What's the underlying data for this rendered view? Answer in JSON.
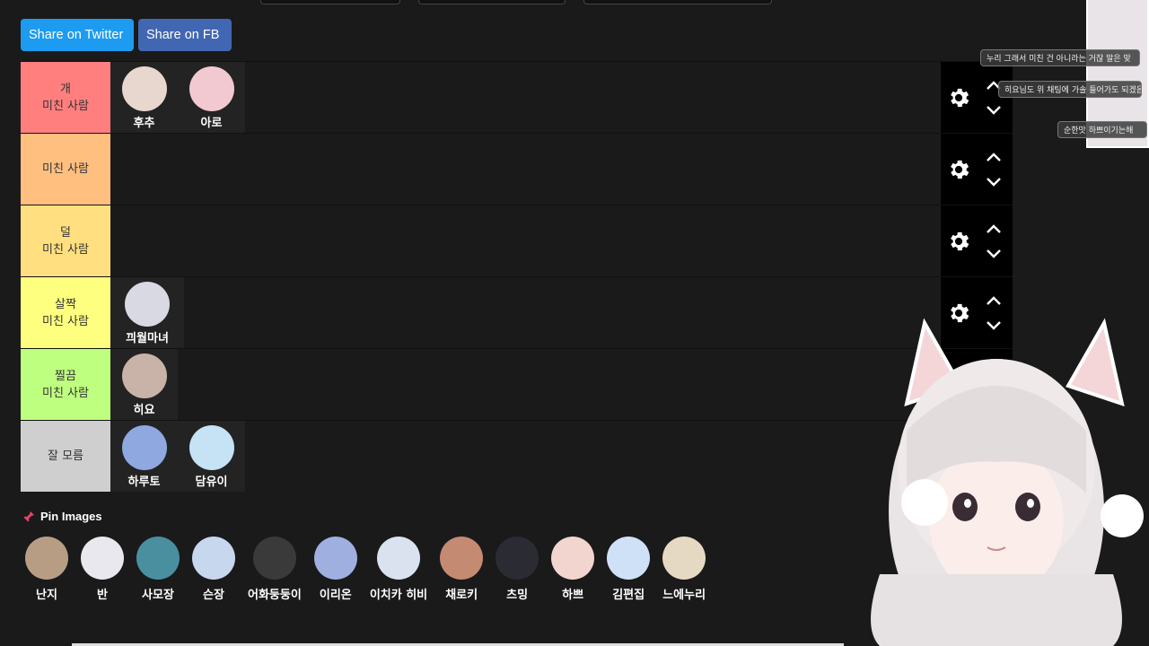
{
  "share": {
    "twitter_label": "Share on Twitter",
    "fb_label": "Share on FB"
  },
  "tiers": [
    {
      "label": "개\n미친 사람",
      "color": "#ff7f7f",
      "items": [
        {
          "name": "후추",
          "color": "#e8d7cf"
        },
        {
          "name": "아로",
          "color": "#f2c9d0"
        }
      ]
    },
    {
      "label": "미친 사람",
      "color": "#ffbf7f",
      "items": []
    },
    {
      "label": "덜\n미친 사람",
      "color": "#ffdf7f",
      "items": []
    },
    {
      "label": "살짝\n미친 사람",
      "color": "#ffff7f",
      "items": [
        {
          "name": "끠월마녀",
          "color": "#d9d9e3"
        }
      ]
    },
    {
      "label": "찔끔\n미친 사람",
      "color": "#bfff7f",
      "items": [
        {
          "name": "히요",
          "color": "#c9b3a8"
        }
      ]
    },
    {
      "label": "잘 모름",
      "color": "#cfcfcf",
      "items": [
        {
          "name": "하루토",
          "color": "#8fa8e0"
        },
        {
          "name": "담유이",
          "color": "#c6e2f5"
        }
      ]
    }
  ],
  "pin": {
    "title": "Pin Images",
    "items": [
      {
        "name": "난지",
        "color": "#b89d85"
      },
      {
        "name": "반",
        "color": "#e8e8ee"
      },
      {
        "name": "사모장",
        "color": "#4a8fa0"
      },
      {
        "name": "슨장",
        "color": "#c7d7ee"
      },
      {
        "name": "어화둥둥이",
        "color": "#3a3a3a"
      },
      {
        "name": "이리온",
        "color": "#9fb0e0"
      },
      {
        "name": "이치카 히비",
        "color": "#d9e2ee"
      },
      {
        "name": "채로키",
        "color": "#c48a72"
      },
      {
        "name": "츠밍",
        "color": "#2b2b33"
      },
      {
        "name": "하쁘",
        "color": "#f3d5d0"
      },
      {
        "name": "김편집",
        "color": "#cfe1f7"
      },
      {
        "name": "느에누리",
        "color": "#e6d9c4"
      }
    ]
  },
  "chat": {
    "messages": [
      "누리 그래서 미친 건 아니라는 거잖 말은 맞",
      "히요님도 위 채팅에 가솔 들어가도 되겠음",
      "순한맛 하쁘이기는해"
    ]
  }
}
